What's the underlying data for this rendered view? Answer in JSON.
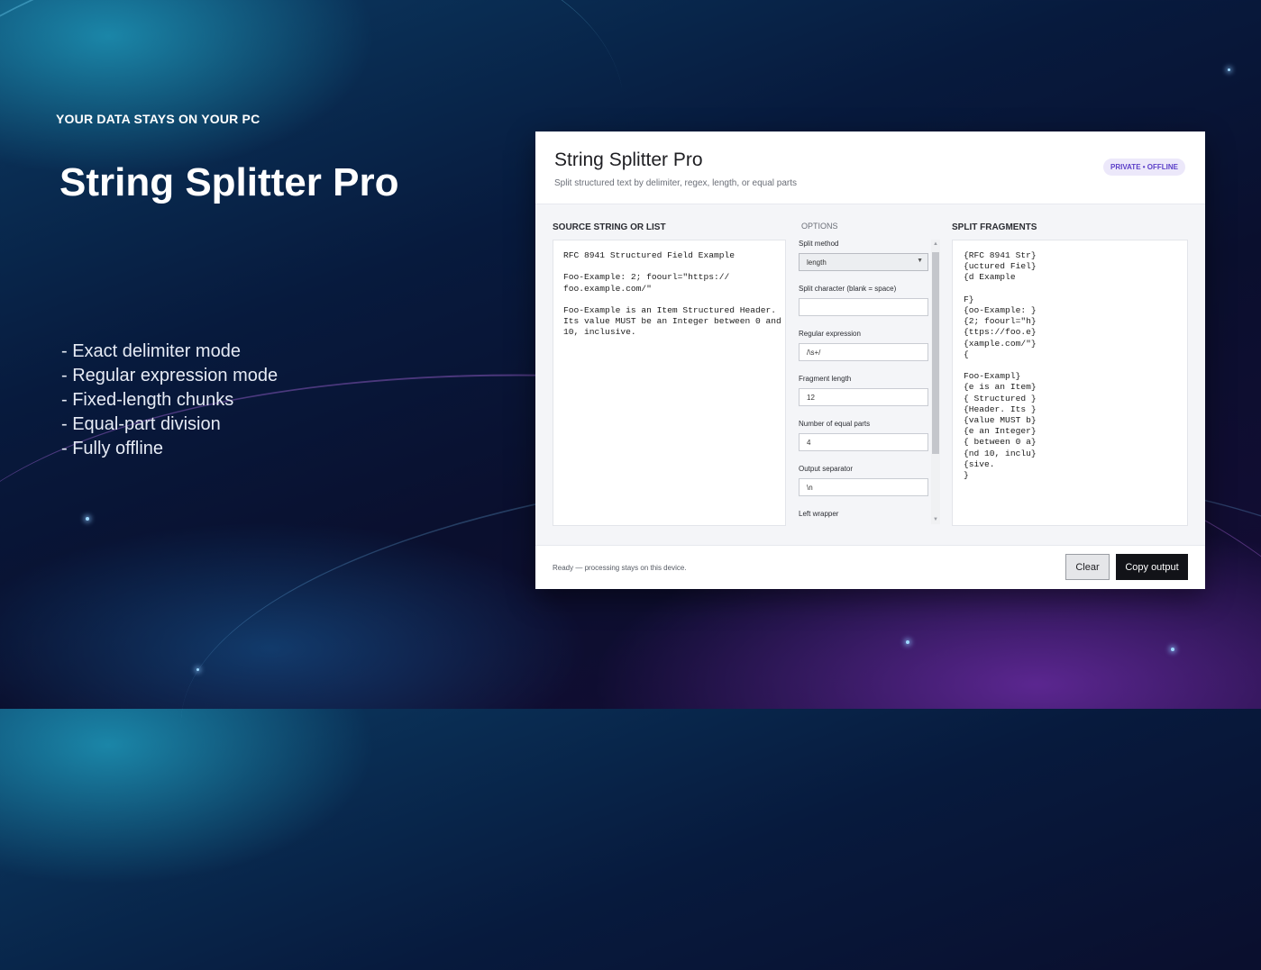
{
  "hero": {
    "kicker": "YOUR DATA STAYS ON YOUR PC",
    "title": "String Splitter Pro",
    "features": [
      "- Exact delimiter mode",
      "- Regular expression mode",
      "- Fixed-length chunks",
      "- Equal-part division",
      "- Fully offline"
    ]
  },
  "app": {
    "title": "String Splitter Pro",
    "subtitle": "Split structured text by delimiter, regex, length, or equal parts",
    "badge": "PRIVATE • OFFLINE",
    "source": {
      "label": "SOURCE STRING OR LIST",
      "text": "RFC 8941 Structured Field Example\n\nFoo-Example: 2; foourl=\"https://\nfoo.example.com/\"\n\nFoo-Example is an Item Structured Header.\nIts value MUST be an Integer between 0 and\n10, inclusive."
    },
    "options": {
      "label": "OPTIONS",
      "split_method": {
        "label": "Split method",
        "value": "length"
      },
      "split_character": {
        "label": "Split character (blank = space)",
        "value": ""
      },
      "regex": {
        "label": "Regular expression",
        "value": "/\\s+/"
      },
      "fragment_length": {
        "label": "Fragment length",
        "value": "12"
      },
      "equal_parts": {
        "label": "Number of equal parts",
        "value": "4"
      },
      "output_separator": {
        "label": "Output separator",
        "value": "\\n"
      },
      "left_wrapper": {
        "label": "Left wrapper"
      }
    },
    "output": {
      "label": "SPLIT FRAGMENTS",
      "text": "{RFC 8941 Str}\n{uctured Fiel}\n{d Example\n\nF}\n{oo-Example: }\n{2; foourl=\"h}\n{ttps://foo.e}\n{xample.com/\"}\n{\n\nFoo-Exampl}\n{e is an Item}\n{ Structured }\n{Header. Its }\n{value MUST b}\n{e an Integer}\n{ between 0 a}\n{nd 10, inclu}\n{sive.\n}"
    },
    "footer": {
      "status": "Ready — processing stays on this device.",
      "clear_label": "Clear",
      "copy_label": "Copy output"
    }
  }
}
